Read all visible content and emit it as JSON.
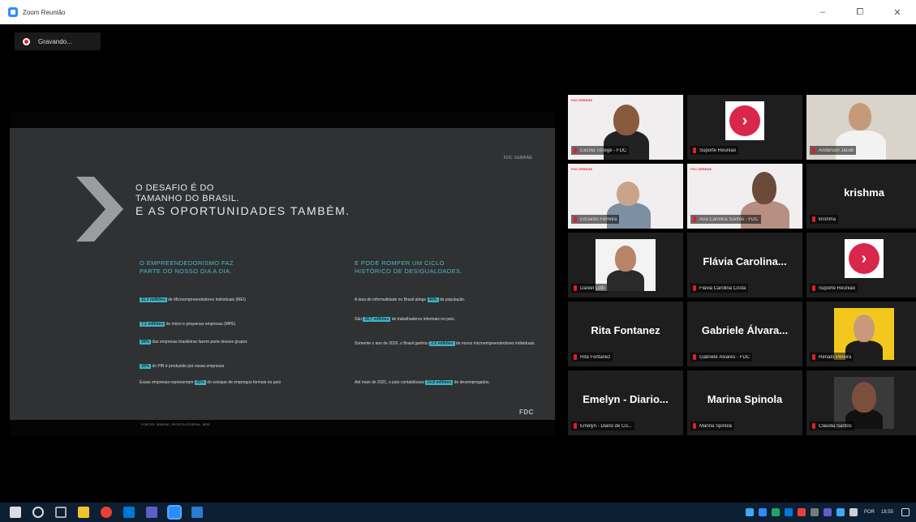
{
  "window": {
    "title": "Zoom Reunião",
    "minimize_glyph": "–",
    "maximize_glyph": "⧠",
    "close_glyph": "✕"
  },
  "recording": {
    "label": "Gravando..."
  },
  "slide": {
    "corner_mark": "FDC·SEBRAE",
    "headline": [
      "O DESAFIO É DO",
      "TAMANHO DO BRASIL.",
      "E AS OPORTUNIDADES TAMBÉM."
    ],
    "left_heading": [
      "O EMPREENDEDORISMO FAZ",
      "PARTE DO NOSSO DIA A DIA."
    ],
    "left_items": [
      {
        "highlight": "11,3 milhões",
        "text": " de Microempreendedores Individuais (MEI)"
      },
      {
        "highlight": "7,1 milhões",
        "text": " de micro e pequenas empresas (MPE)"
      },
      {
        "highlight": "99%",
        "text": " das empresas brasileiras fazem parte desses grupos"
      },
      {
        "highlight": "30%",
        "text": " do PIB é produzido por essas empresas"
      },
      {
        "highlight": "",
        "text": "Essas empresas representam ",
        "highlight2": "55%",
        "text2": " do estoque de empregos formais no país"
      }
    ],
    "right_heading": [
      "E PODE ROMPER UM CICLO",
      "HISTÓRICO DE DESIGUALDADES."
    ],
    "right_items": [
      {
        "text": "A taxa de informalidade no Brasil atinge ",
        "highlight": "40%",
        "text2": " da população."
      },
      {
        "text": "São ",
        "highlight": "38,7 milhões",
        "text2": " de trabalhadores informais no país."
      },
      {
        "text": "Somente o ano de 2020, o Brasil ganhou ",
        "highlight": "2,6 milhões",
        "text2": " de novos microempreendedores individuais."
      },
      {
        "text": "Até maio de 2021, o país contabilizava ",
        "highlight": "14,8 milhões",
        "text2": " de desempregados."
      }
    ],
    "source": "FONTES: SEBRAE, RECEITA FEDERAL, IBGE",
    "logo": "FDC"
  },
  "participants": [
    {
      "display_name": "Cecília Tonegé - FDC",
      "kind": "video-light"
    },
    {
      "display_name": "Suporte Reunião",
      "kind": "logo"
    },
    {
      "display_name": "Anderson Jacob",
      "kind": "video-room"
    },
    {
      "display_name": "Eduardo Ferreira",
      "kind": "video-light"
    },
    {
      "display_name": "Ana Carolina Santos - FDC",
      "kind": "video-light",
      "active": true
    },
    {
      "display_name": "krishma",
      "tile_text": "krishma",
      "kind": "name"
    },
    {
      "display_name": "Daniel Lotti",
      "kind": "photo"
    },
    {
      "display_name": "Flávia Carolina Costa",
      "tile_text": "Flávia Carolina...",
      "kind": "name"
    },
    {
      "display_name": "Suporte Reunião",
      "kind": "logo"
    },
    {
      "display_name": "Rita Fontanez",
      "tile_text": "Rita Fontanez",
      "kind": "name"
    },
    {
      "display_name": "Gabriele Álvares - FDC",
      "tile_text": "Gabriele Álvara...",
      "kind": "name"
    },
    {
      "display_name": "Renato Pereira",
      "kind": "photo-yellow"
    },
    {
      "display_name": "Emelyn - Diario de Co...",
      "tile_text": "Emelyn - Diario...",
      "kind": "name"
    },
    {
      "display_name": "Marina Spinola",
      "tile_text": "Marina Spinola",
      "kind": "name"
    },
    {
      "display_name": "Cláudia Santos",
      "kind": "photo-dark"
    }
  ],
  "taskbar": {
    "time": "18:55",
    "language": "POR"
  },
  "colors": {
    "accent_teal": "#40b4c4",
    "active_speaker": "#b8d84c",
    "brand_red": "#d8274a"
  }
}
